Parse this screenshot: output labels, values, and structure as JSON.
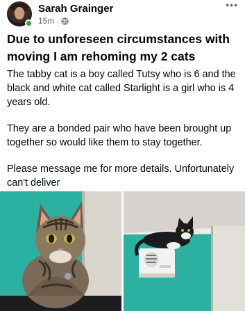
{
  "post": {
    "author": "Sarah Grainger",
    "time": "15m",
    "separator": "·",
    "privacy_icon": "globe-icon",
    "more_icon": "more-options-icon",
    "title": "Due to unforeseen circumstances with moving I am rehoming my 2 cats",
    "paragraphs": [
      "The tabby cat is a boy called Tutsy who is 6 and the black and white cat called Starlight is a girl who is 4 years old.",
      "They are a bonded pair who have been brought up together so would like them to stay together.",
      "Please message me for more details. Unfortunately can't deliver"
    ]
  },
  "colors": {
    "online": "#31a24c",
    "meta_text": "#65676b",
    "wall_teal": "#2fb7a9"
  }
}
